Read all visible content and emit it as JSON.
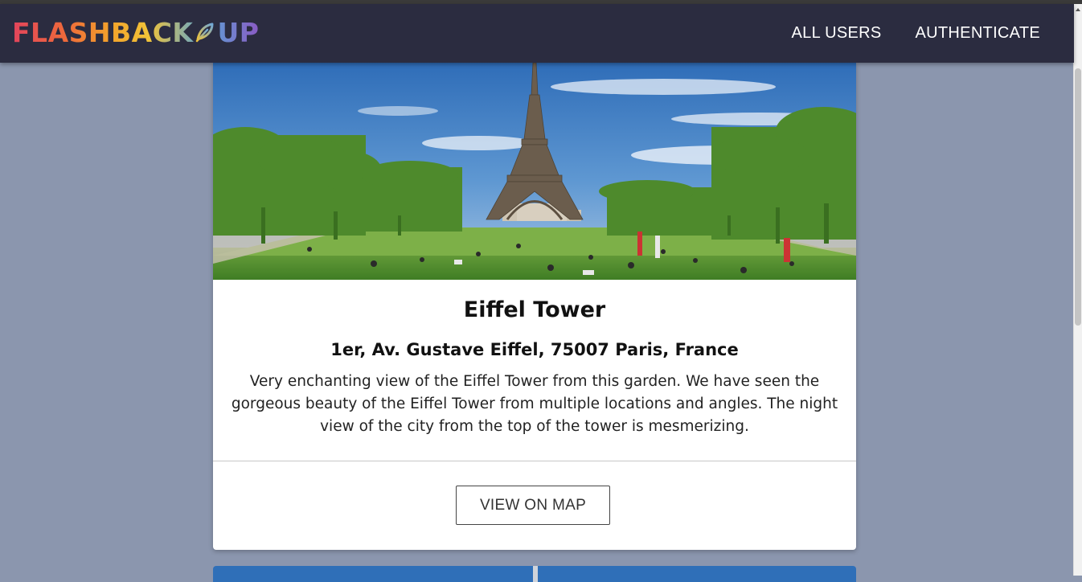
{
  "navbar": {
    "logo_left": "FLASHBACK",
    "logo_right": "UP",
    "logo_icon": "feather-icon",
    "links": [
      "ALL USERS",
      "AUTHENTICATE"
    ]
  },
  "place_card": {
    "image": "eiffel-tower-photo",
    "title": "Eiffel Tower",
    "address": "1er, Av. Gustave Eiffel, 75007 Paris, France",
    "description": "Very enchanting view of the Eiffel Tower from this garden. We have seen the gorgeous beauty of the Eiffel Tower from multiple locations and angles. The night view of the city from the top of the tower is mesmerizing.",
    "button_label": "VIEW ON MAP"
  },
  "colors": {
    "navbar_bg": "#2b2c40",
    "page_bg": "#8b96ae",
    "card_bg": "#ffffff"
  }
}
